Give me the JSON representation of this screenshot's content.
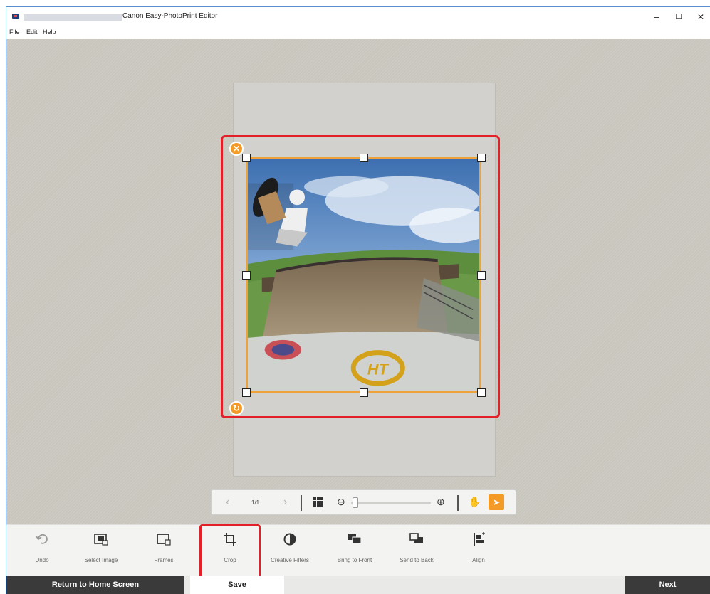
{
  "window": {
    "title": "Canon Easy-PhotoPrint Editor",
    "controls": {
      "minimize": "–",
      "maximize": "☐",
      "close": "✕"
    }
  },
  "menu": [
    {
      "label": "File"
    },
    {
      "label": "Edit"
    },
    {
      "label": "Help"
    }
  ],
  "canvas": {
    "photo_description": "skateboarder at skate park half-pipe",
    "delete_icon": "✕",
    "rotate_icon": "↻"
  },
  "navigation": {
    "prev_icon": "‹",
    "page_indicator": "1/1",
    "next_icon": "›",
    "zoom_out_icon": "⊖",
    "zoom_in_icon": "⊕",
    "hand_icon": "✋",
    "pointer_icon": "➤",
    "zoom_level": 0.05
  },
  "toolbar": {
    "tools": [
      {
        "label": "Undo",
        "icon": "undo-icon"
      },
      {
        "label": "Select Image",
        "icon": "select-image-icon"
      },
      {
        "label": "Frames",
        "icon": "frames-icon"
      },
      {
        "label": "Crop",
        "icon": "crop-icon"
      },
      {
        "label": "Creative Filters",
        "icon": "creative-filters-icon"
      },
      {
        "label": "Bring to Front",
        "icon": "bring-to-front-icon"
      },
      {
        "label": "Send to Back",
        "icon": "send-to-back-icon"
      },
      {
        "label": "Align",
        "icon": "align-icon"
      }
    ]
  },
  "bottom": {
    "home_label": "Return to Home Screen",
    "save_label": "Save",
    "next_label": "Next"
  },
  "colors": {
    "accent": "#f39b26",
    "highlight": "#e2202a",
    "dark_button": "#3a3a3a"
  }
}
